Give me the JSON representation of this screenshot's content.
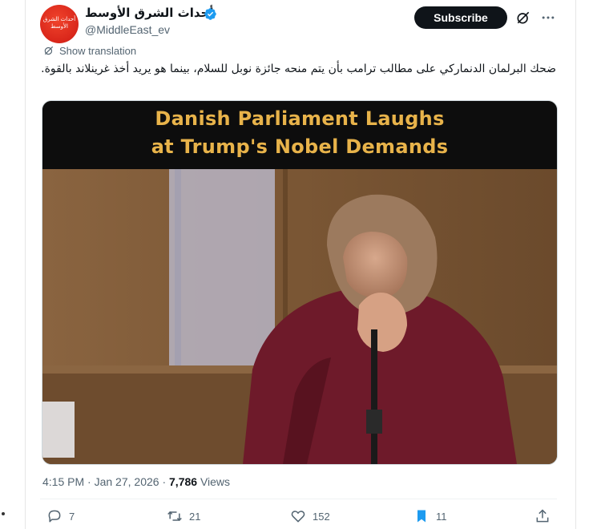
{
  "author": {
    "display_name": "أحداث الشرق الأوسط",
    "handle": "@MiddleEast_ev",
    "avatar_text": "أحداث الشرق الأوسط",
    "verified": true
  },
  "header": {
    "subscribe_label": "Subscribe",
    "icons": [
      "grok-icon",
      "more-icon"
    ]
  },
  "translation": {
    "label": "Show translation"
  },
  "tweet": {
    "text": "ضحك البرلمان الدنماركي على مطالب ترامب بأن يتم منحه جائزة نوبل للسلام، بينما هو يريد أخذ غرينلاند بالقوة."
  },
  "media": {
    "caption_line1": "Danish Parliament Laughs",
    "caption_line2": "at Trump's Nobel Demands"
  },
  "meta": {
    "time": "4:15 PM",
    "separator": " · ",
    "date": "Jan 27, 2026",
    "views_count": "7,786",
    "views_label": " Views"
  },
  "actions": {
    "replies": "7",
    "reposts": "21",
    "likes": "152",
    "bookmarks": "11"
  },
  "colors": {
    "text": "#0f1419",
    "secondary": "#536471",
    "verified": "#1d9bf0",
    "bookmark_active": "#1d9bf0",
    "caption": "#e8b34a",
    "avatar": "#d9261a"
  }
}
